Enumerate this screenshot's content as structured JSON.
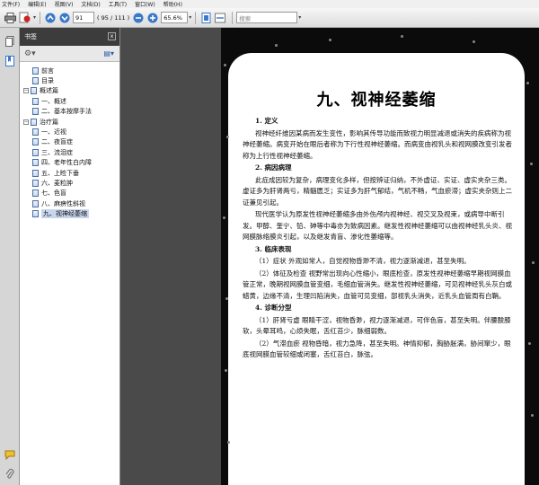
{
  "menu": [
    "文件(F)",
    "编辑(E)",
    "视图(V)",
    "文档(D)",
    "工具(T)",
    "窗口(W)",
    "帮助(H)"
  ],
  "toolbar": {
    "page_number": "91",
    "page_count": "( 95 / 111 )",
    "zoom": "65.6%",
    "search_placeholder": "搜索"
  },
  "panel": {
    "title": "书签",
    "close_label": "x"
  },
  "bookmarks": [
    {
      "label": "前言",
      "level": 1,
      "expander": ""
    },
    {
      "label": "目录",
      "level": 1,
      "expander": ""
    },
    {
      "label": "概述篇",
      "level": 0,
      "expander": "−"
    },
    {
      "label": "一、概述",
      "level": 1,
      "expander": ""
    },
    {
      "label": "二、基本按摩手法",
      "level": 1,
      "expander": ""
    },
    {
      "label": "治疗篇",
      "level": 0,
      "expander": "−"
    },
    {
      "label": "一、近视",
      "level": 1,
      "expander": ""
    },
    {
      "label": "二、夜盲症",
      "level": 1,
      "expander": ""
    },
    {
      "label": "三、流泪症",
      "level": 1,
      "expander": ""
    },
    {
      "label": "四、老年性白内障",
      "level": 1,
      "expander": ""
    },
    {
      "label": "五、上睑下垂",
      "level": 1,
      "expander": ""
    },
    {
      "label": "六、麦粒肿",
      "level": 1,
      "expander": ""
    },
    {
      "label": "七、色盲",
      "level": 1,
      "expander": ""
    },
    {
      "label": "八、麻痹性斜视",
      "level": 1,
      "expander": ""
    },
    {
      "label": "九、视神经萎缩",
      "level": 1,
      "expander": "",
      "selected": true
    }
  ],
  "document": {
    "title": "九、视神经萎缩",
    "blocks": [
      {
        "type": "heading",
        "text": "1. 定义"
      },
      {
        "type": "para",
        "text": "视神经纤维因某病而发生变性，影响其传导功能而致视力明显减退或消失的疾病称为视神经萎缩。病变开始在眼后者称为下行性视神经萎缩。而病变由视乳头和视网膜改变引发者称为上行性视神经萎缩。"
      },
      {
        "type": "heading",
        "text": "2. 病因病理"
      },
      {
        "type": "para",
        "text": "此症成因较为复杂，病理变化多样，但按辨证归纳，不外虚证、实证、虚实夹杂三类。虚证多为肝肾两亏，精髓匮乏；实证多为肝气郁结，气机不畅，气血瘀滞；虚实夹杂则上二证兼见引起。"
      },
      {
        "type": "para",
        "text": "现代医学认为原发性视神经萎缩多由外伤颅内视神经、视交叉及视束，或病导中断引发。甲醇、奎宁、铅、砷等中毒亦为致病因素。继发性视神经萎缩可以由视神经乳头炎、视网膜脉络膜炎引起，以及继发青盲、渗化性萎缩等。"
      },
      {
        "type": "heading",
        "text": "3. 临床表现"
      },
      {
        "type": "para",
        "text": "（1）症状 外观如常人，自觉视物昏渺不清，视力逐渐减退，甚至失明。"
      },
      {
        "type": "para",
        "text": "（2）体征及检查 视野常出现向心性缩小，眼底检查，原发性视神经萎缩早期视网膜血管正常，晚期视网膜血管变细，毛细血管消失。继发性视神经萎缩，可见视神经乳头灰白或蜡黄，边缘不清，生理凹陷消失，血管可见变细，部视乳头消失，近乳头血管周有白鞘。"
      },
      {
        "type": "heading",
        "text": "4. 诊断分型"
      },
      {
        "type": "para",
        "text": "（1）肝肾亏虚 眼睛干涩，视物昏渺，视力逐渐减退，可伴色盲，甚至失明。伴腰酸膝软，头晕耳鸣，心烦失眠，舌红苔少，脉细弱数。"
      },
      {
        "type": "para",
        "text": "（2）气滞血瘀 视物昏暗，视力急降，甚至失明。神情抑郁，胸胁胀满，胁间窜少，眼底视网膜血管较细或闭塞，舌红苔白，脉弦。"
      }
    ]
  }
}
